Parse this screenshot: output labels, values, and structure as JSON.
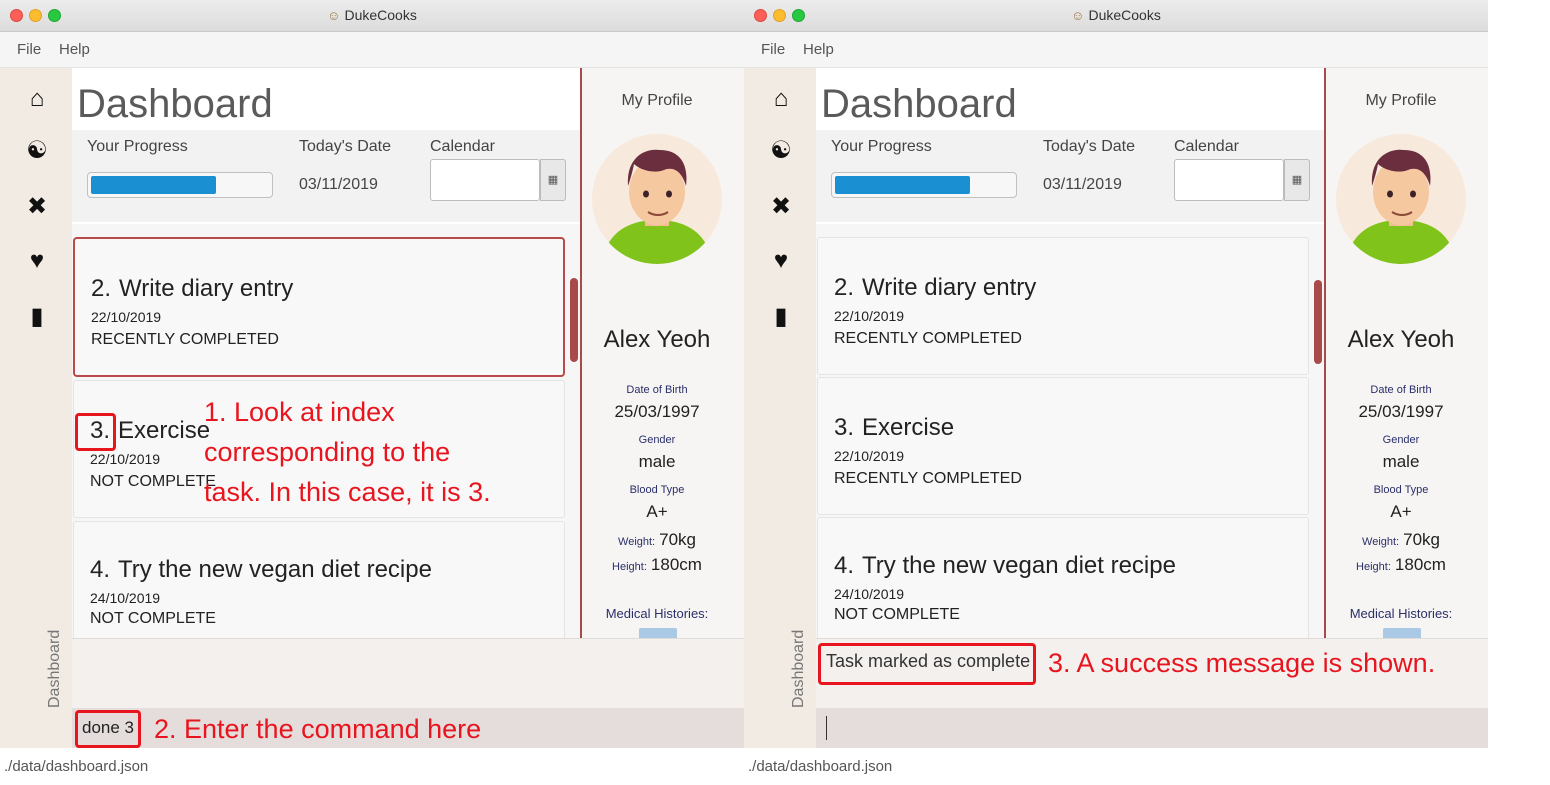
{
  "app": {
    "title": "DukeCooks",
    "title_icon": "chef-icon"
  },
  "menu": {
    "file": "File",
    "help": "Help"
  },
  "sidebar": {
    "items": [
      "home-icon",
      "chef-hat-icon",
      "dumbbell-icon",
      "heartbeat-icon",
      "book-icon"
    ],
    "vertical_label": "Dashboard"
  },
  "dashboard": {
    "title": "Dashboard",
    "progress_label": "Your Progress",
    "progress_fraction": 0.7,
    "date_label": "Today's Date",
    "date_value": "03/11/2019",
    "calendar_label": "Calendar",
    "calendar_button_icon": "calendar-icon"
  },
  "profile": {
    "heading": "My Profile",
    "name": "Alex Yeoh",
    "dob_label": "Date of Birth",
    "dob": "25/03/1997",
    "gender_label": "Gender",
    "gender": "male",
    "blood_label": "Blood Type",
    "blood": "A+",
    "weight_label": "Weight:",
    "weight": "70kg",
    "height_label": "Height:",
    "height": "180cm",
    "medical_label": "Medical Histories:"
  },
  "status_bar": "./data/dashboard.json",
  "left": {
    "tasks": [
      {
        "index": "2.",
        "name": "Write diary entry",
        "date": "22/10/2019",
        "status": "RECENTLY COMPLETED"
      },
      {
        "index": "3.",
        "name": "Exercise",
        "date": "22/10/2019",
        "status": "NOT COMPLETE"
      },
      {
        "index": "4.",
        "name": "Try the new vegan diet recipe",
        "date": "24/10/2019",
        "status": "NOT COMPLETE"
      }
    ],
    "result_text": "",
    "command_text": "done 3"
  },
  "right": {
    "tasks": [
      {
        "index": "2.",
        "name": "Write diary entry",
        "date": "22/10/2019",
        "status": "RECENTLY COMPLETED"
      },
      {
        "index": "3.",
        "name": "Exercise",
        "date": "22/10/2019",
        "status": "RECENTLY COMPLETED"
      },
      {
        "index": "4.",
        "name": "Try the new vegan diet recipe",
        "date": "24/10/2019",
        "status": "NOT COMPLETE"
      }
    ],
    "result_text": "Task marked as complete",
    "command_text": ""
  },
  "annotations": {
    "step1": [
      "1. Look at index",
      "corresponding to the",
      "task. In this case, it is 3."
    ],
    "step2": "2. Enter the command here",
    "step3": "3. A success message is shown.",
    "color": "#e8141e"
  }
}
